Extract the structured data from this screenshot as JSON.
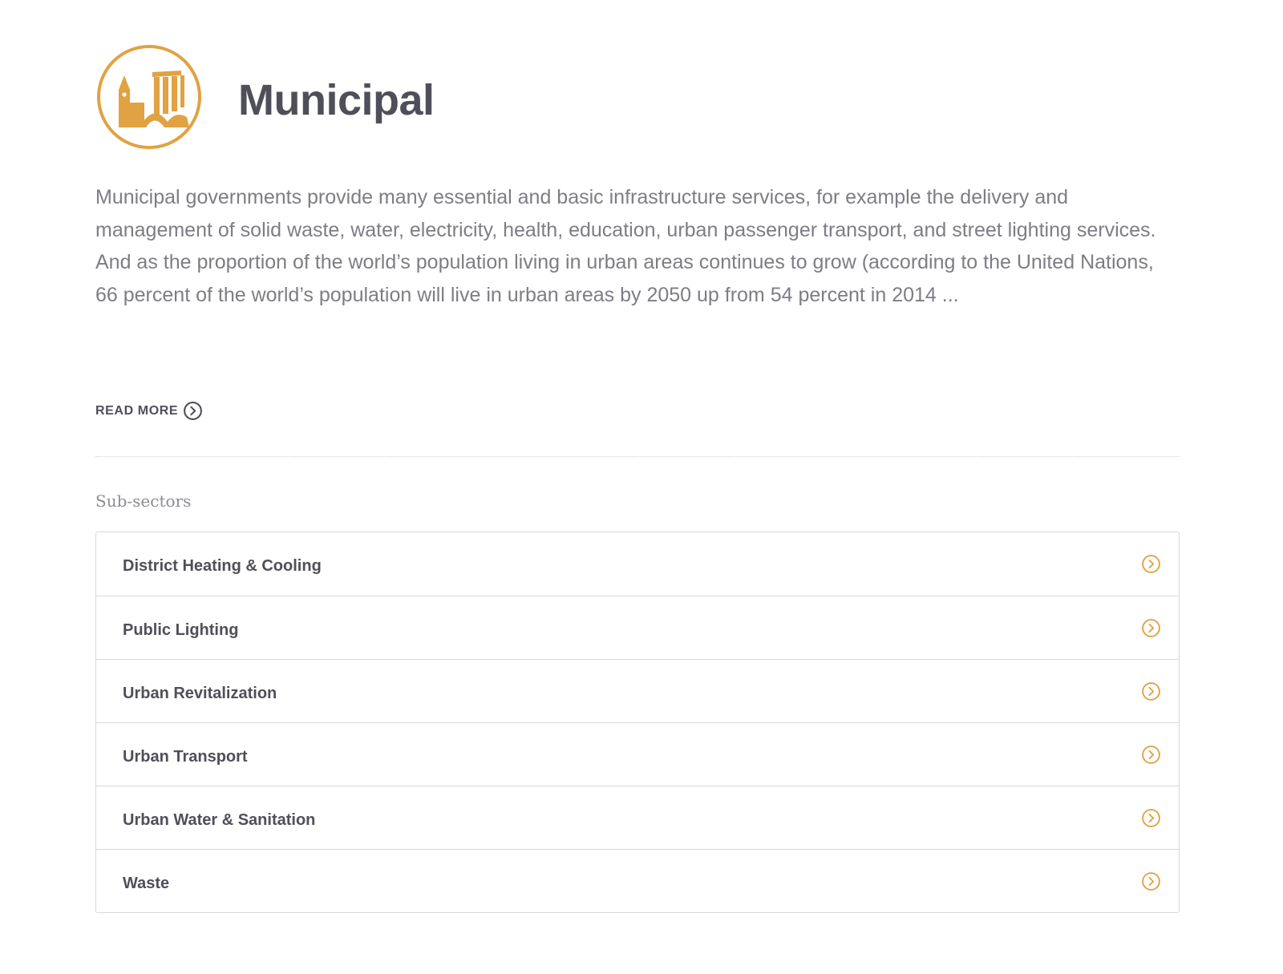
{
  "sector": {
    "title": "Municipal",
    "icon": "municipal-buildings-icon",
    "accent_color": "#e0a242",
    "description": "Municipal governments provide many essential and basic infrastructure services, for example the delivery and management of solid waste, water, electricity, health, education, urban passenger transport, and street lighting services. And as the proportion of the world’s population living in urban areas continues to grow (according to the United Nations, 66 percent of the world’s population will live in urban areas by 2050 up from 54 percent in 2014 ...",
    "read_more_label": "READ MORE",
    "read_more_icon": "circle-chevron-right-icon"
  },
  "subsectors": {
    "heading": "Sub-sectors",
    "item_icon": "circle-chevron-right-icon",
    "items": [
      {
        "label": "District Heating & Cooling"
      },
      {
        "label": "Public Lighting"
      },
      {
        "label": "Urban Revitalization"
      },
      {
        "label": "Urban Transport"
      },
      {
        "label": "Urban Water & Sanitation"
      },
      {
        "label": "Waste"
      }
    ]
  }
}
